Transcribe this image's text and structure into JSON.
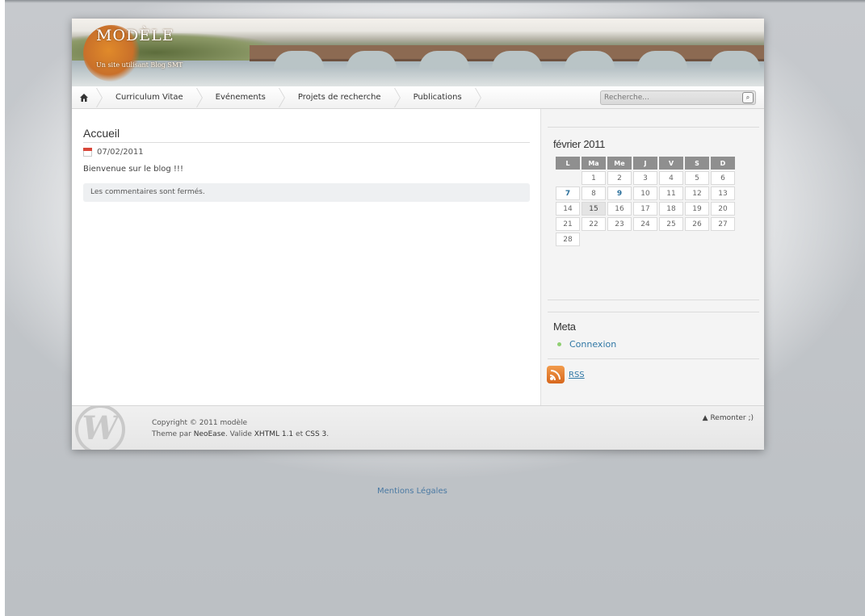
{
  "header": {
    "site_title": "MODÈLE",
    "site_subtitle": "Un site utilisant Blog SMT"
  },
  "nav": {
    "home_icon": "home-icon",
    "items": [
      {
        "label": "Curriculum Vitae"
      },
      {
        "label": "Evénements"
      },
      {
        "label": "Projets de recherche"
      },
      {
        "label": "Publications"
      }
    ],
    "search_placeholder": "Recherche...",
    "search_button_icon": "search-icon",
    "search_button_glyph": "⌕"
  },
  "post": {
    "title": "Accueil",
    "date": "07/02/2011",
    "body": "Bienvenue sur le blog !!!",
    "comments_note": "Les commentaires sont fermés."
  },
  "sidebar": {
    "calendar": {
      "title": "février 2011",
      "weekdays": [
        "L",
        "Ma",
        "Me",
        "J",
        "V",
        "S",
        "D"
      ],
      "weeks": [
        [
          "",
          "1",
          "2",
          "3",
          "4",
          "5",
          "6"
        ],
        [
          "7",
          "8",
          "9",
          "10",
          "11",
          "12",
          "13"
        ],
        [
          "14",
          "15",
          "16",
          "17",
          "18",
          "19",
          "20"
        ],
        [
          "21",
          "22",
          "23",
          "24",
          "25",
          "26",
          "27"
        ],
        [
          "28",
          "",
          "",
          "",
          "",
          "",
          ""
        ]
      ],
      "linked_days": [
        "7",
        "9"
      ],
      "today": "15"
    },
    "meta": {
      "title": "Meta",
      "items": [
        {
          "label": "Connexion"
        }
      ]
    },
    "rss_label": "RSS"
  },
  "footer": {
    "copyright": "Copyright © 2011 modèle",
    "theme_prefix": "Theme par",
    "theme_author": "NeoEase",
    "valid_prefix": ". Valide",
    "xhtml": "XHTML 1.1",
    "and": "et",
    "css": "CSS 3",
    "end": ".",
    "back_to_top": "▲ Remonter ;)"
  },
  "legal_link": "Mentions Légales",
  "colors": {
    "link": "#2f77a5",
    "calendar_header": "#8f8f8f",
    "rss_orange": "#e37a2c"
  }
}
